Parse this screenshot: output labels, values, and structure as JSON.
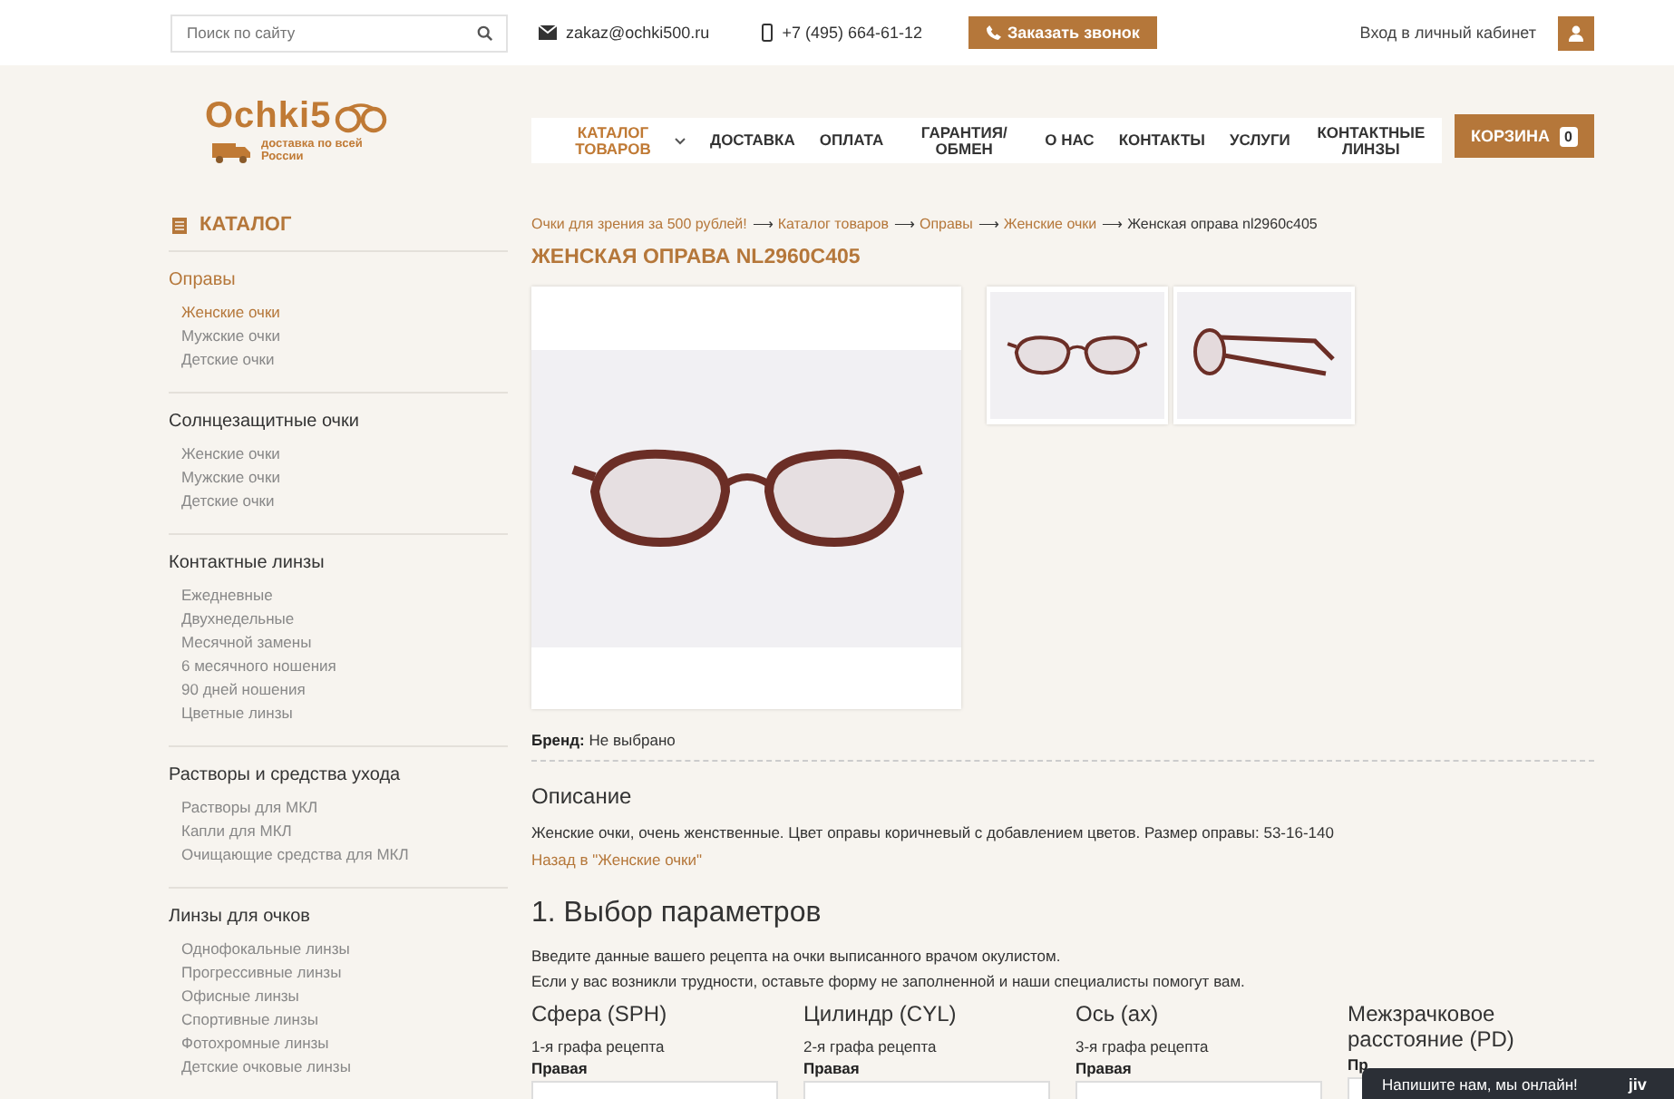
{
  "topbar": {
    "search": {
      "placeholder": "Поиск по сайту"
    },
    "email": "zakaz@ochki500.ru",
    "phone": "+7 (495) 664-61-12",
    "call_button": "Заказать звонок",
    "login": "Вход в личный кабинет"
  },
  "logo": {
    "name": "Ochki5",
    "tagline": "доставка по всей России"
  },
  "nav": [
    {
      "label": "КАТАЛОГ ТОВАРОВ",
      "selected": true,
      "dropdown": true
    },
    {
      "label": "ДОСТАВКА",
      "selected": false,
      "dropdown": false
    },
    {
      "label": "ОПЛАТА",
      "selected": false,
      "dropdown": false
    },
    {
      "label": "ГАРАНТИЯ/ ОБМЕН",
      "selected": false,
      "dropdown": false
    },
    {
      "label": "О НАС",
      "selected": false,
      "dropdown": false
    },
    {
      "label": "КОНТАКТЫ",
      "selected": false,
      "dropdown": false
    },
    {
      "label": "УСЛУГИ",
      "selected": false,
      "dropdown": false
    },
    {
      "label": "КОНТАКТНЫЕ ЛИНЗЫ",
      "selected": false,
      "dropdown": false
    }
  ],
  "cart": {
    "label": "КОРЗИНА",
    "count": "0"
  },
  "sidebar": {
    "title": "КАТАЛОГ",
    "groups": [
      {
        "label": "Оправы",
        "selected": true,
        "children": [
          {
            "label": "Женские очки",
            "selected": true
          },
          {
            "label": "Мужские очки",
            "selected": false
          },
          {
            "label": "Детские очки",
            "selected": false
          }
        ]
      },
      {
        "label": "Солнцезащитные очки",
        "selected": false,
        "children": [
          {
            "label": "Женские очки",
            "selected": false
          },
          {
            "label": "Мужские очки",
            "selected": false
          },
          {
            "label": "Детские очки",
            "selected": false
          }
        ]
      },
      {
        "label": "Контактные линзы",
        "selected": false,
        "children": [
          {
            "label": "Ежедневные",
            "selected": false
          },
          {
            "label": "Двухнедельные",
            "selected": false
          },
          {
            "label": "Месячной замены",
            "selected": false
          },
          {
            "label": "6 месячного ношения",
            "selected": false
          },
          {
            "label": "90 дней ношения",
            "selected": false
          },
          {
            "label": "Цветные линзы",
            "selected": false
          }
        ]
      },
      {
        "label": "Растворы и средства ухода",
        "selected": false,
        "children": [
          {
            "label": "Растворы для МКЛ",
            "selected": false
          },
          {
            "label": "Капли для МКЛ",
            "selected": false
          },
          {
            "label": "Очищающие средства для МКЛ",
            "selected": false
          }
        ]
      },
      {
        "label": "Линзы для очков",
        "selected": false,
        "children": [
          {
            "label": "Однофокальные линзы",
            "selected": false
          },
          {
            "label": "Прогрессивные линзы",
            "selected": false
          },
          {
            "label": "Офисные линзы",
            "selected": false
          },
          {
            "label": "Спортивные линзы",
            "selected": false
          },
          {
            "label": "Фотохромные линзы",
            "selected": false
          },
          {
            "label": "Детские очковые линзы",
            "selected": false
          }
        ]
      }
    ]
  },
  "breadcrumbs": {
    "separator": "⟶",
    "items": [
      "Очки для зрения за 500 рублей!",
      "Каталог товаров",
      "Оправы",
      "Женские очки",
      "Женская оправа nl2960c405"
    ]
  },
  "product": {
    "title": "ЖЕНСКАЯ ОПРАВА NL2960C405",
    "brand_label": "Бренд:",
    "brand_value": "Не выбрано",
    "description_title": "Описание",
    "description": "Женские очки, очень женственные. Цвет оправы коричневый с добавлением цветов. Размер оправы: 53-16-140",
    "back_link": "Назад в \"Женские очки\""
  },
  "params": {
    "title": "1. Выбор параметров",
    "intro": [
      "Введите данные вашего рецепта на очки выписанного врачом окулистом.",
      "Если у вас возникли трудности, оставьте форму не заполненной и наши специалисты помогут вам."
    ],
    "columns": [
      {
        "title": "Сфера (SPH)",
        "hint": "1-я графа рецепта",
        "eye": "Правая"
      },
      {
        "title": "Цилиндр (CYL)",
        "hint": "2-я графа рецепта",
        "eye": "Правая"
      },
      {
        "title": "Ось (ax)",
        "hint": "3-я графа рецепта",
        "eye": "Правая"
      },
      {
        "title": "Межзрачковое расстояние (PD)",
        "eye": "Пр"
      }
    ]
  },
  "chat": {
    "label": "Напишите нам, мы онлайн!",
    "brand": "jiv"
  }
}
